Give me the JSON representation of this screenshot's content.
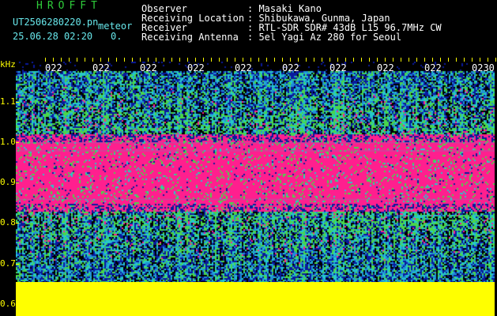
{
  "header": {
    "app_name": "HROFFT",
    "filename": "UT2506280220.pn",
    "mode": "meteor",
    "datetime": "25.06.28 02:20",
    "count": "0.",
    "fields": [
      {
        "label": "Observer",
        "value": ": Masaki Kano"
      },
      {
        "label": "Receiving Location",
        "value": ": Shibukawa, Gunma, Japan"
      },
      {
        "label": "Receiver",
        "value": ": RTL-SDR SDR# 43dB L15 96.7MHz CW"
      },
      {
        "label": "Receiving Antenna",
        "value": ": 5el Yagi Az 280 for Seoul"
      }
    ]
  },
  "spectrogram": {
    "y_unit": "kHz",
    "y_labels": [
      "1.1",
      "1.0",
      "0.9",
      "0.8",
      "0.7",
      "0.6"
    ],
    "y_values": [
      1.1,
      1.0,
      0.9,
      0.8,
      0.7,
      0.6
    ],
    "y_range": [
      0.57,
      1.2
    ],
    "time_labels": [
      "022",
      "022",
      "022",
      "022",
      "022",
      "022",
      "022",
      "022",
      "022",
      "0230"
    ],
    "signal_band_khz": [
      0.83,
      1.02
    ],
    "noise_floor_khz": 0.655,
    "colors": {
      "background": "#000000",
      "noise_low": "#0a1a9c",
      "noise_mid": "#1f8fd8",
      "noise_cyan": "#26c9c9",
      "noise_green": "#49d64a",
      "signal": "#ff1f8e",
      "floor": "#ffff00",
      "axis": "#ffff00"
    }
  }
}
